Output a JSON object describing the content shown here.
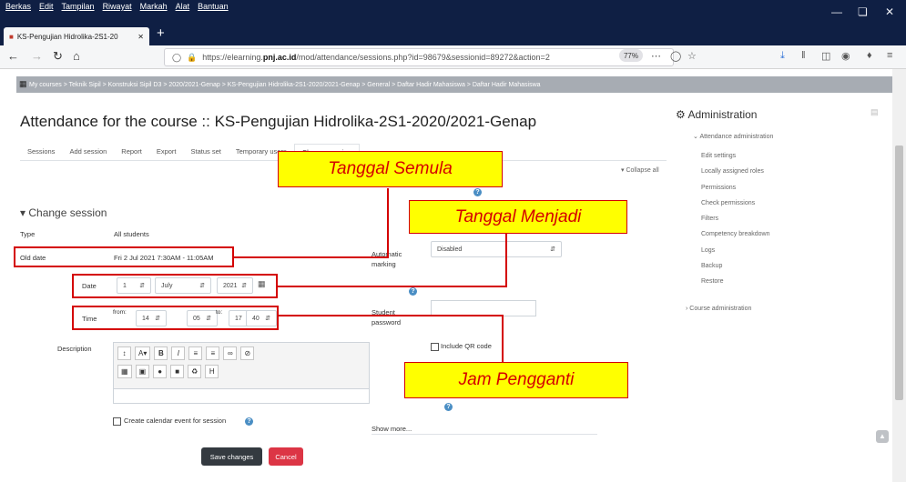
{
  "browser": {
    "menu": [
      "Berkas",
      "Edit",
      "Tampilan",
      "Riwayat",
      "Markah",
      "Alat",
      "Bantuan"
    ],
    "tab_title": "KS-Pengujian Hidrolika-2S1-20",
    "url_prefix": "https://elearning.",
    "url_host": "pnj.ac.id",
    "url_path": "/mod/attendance/sessions.php?id=98679&sessionid=89272&action=2",
    "zoom": "77%"
  },
  "breadcrumb": "My courses  >  Teknik Sipil  >  Konstruksi Sipil D3  >  2020/2021-Genap  >  KS-Pengujian Hidrolika-2S1-2020/2021-Genap  >  General  >  Daftar Hadir Mahasiswa  >  Daftar Hadir Mahasiswa",
  "page": {
    "title": "Attendance for the course :: KS-Pengujian Hidrolika-2S1-2020/2021-Genap",
    "tabs": [
      "Sessions",
      "Add session",
      "Report",
      "Export",
      "Status set",
      "Temporary users",
      "Change session"
    ],
    "collapse_all": "Collapse all",
    "section_title": "Change session"
  },
  "form": {
    "type_label": "Type",
    "type_value": "All students",
    "old_date_label": "Old date",
    "old_date_value": "Fri 2 Jul 2021 7:30AM - 11:05AM",
    "date_label": "Date",
    "date_day": "1",
    "date_month": "July",
    "date_year": "2021",
    "time_label": "Time",
    "from_label": "from:",
    "to_label": "to:",
    "from_hour": "14",
    "from_min": "05",
    "to_hour": "17",
    "to_min": "40",
    "description_label": "Description",
    "auto_marking_label": "Automatic marking",
    "auto_marking_value": "Disabled",
    "student_password_label": "Student password",
    "include_qr": "Include QR code",
    "calendar_event": "Create calendar event for session",
    "show_more": "Show more...",
    "save_button": "Save changes",
    "cancel_button": "Cancel"
  },
  "admin": {
    "title": "Administration",
    "subheading": "Attendance administration",
    "items": [
      "Edit settings",
      "Locally assigned roles",
      "Permissions",
      "Check permissions",
      "Filters",
      "Competency breakdown",
      "Logs",
      "Backup",
      "Restore"
    ],
    "course_admin": "Course administration"
  },
  "annotations": {
    "tanggal_semula": "Tanggal Semula",
    "tanggal_menjadi": "Tanggal Menjadi",
    "jam_pengganti": "Jam Pengganti",
    "fill_color": "#ffff00",
    "border_color": "#d40000"
  }
}
